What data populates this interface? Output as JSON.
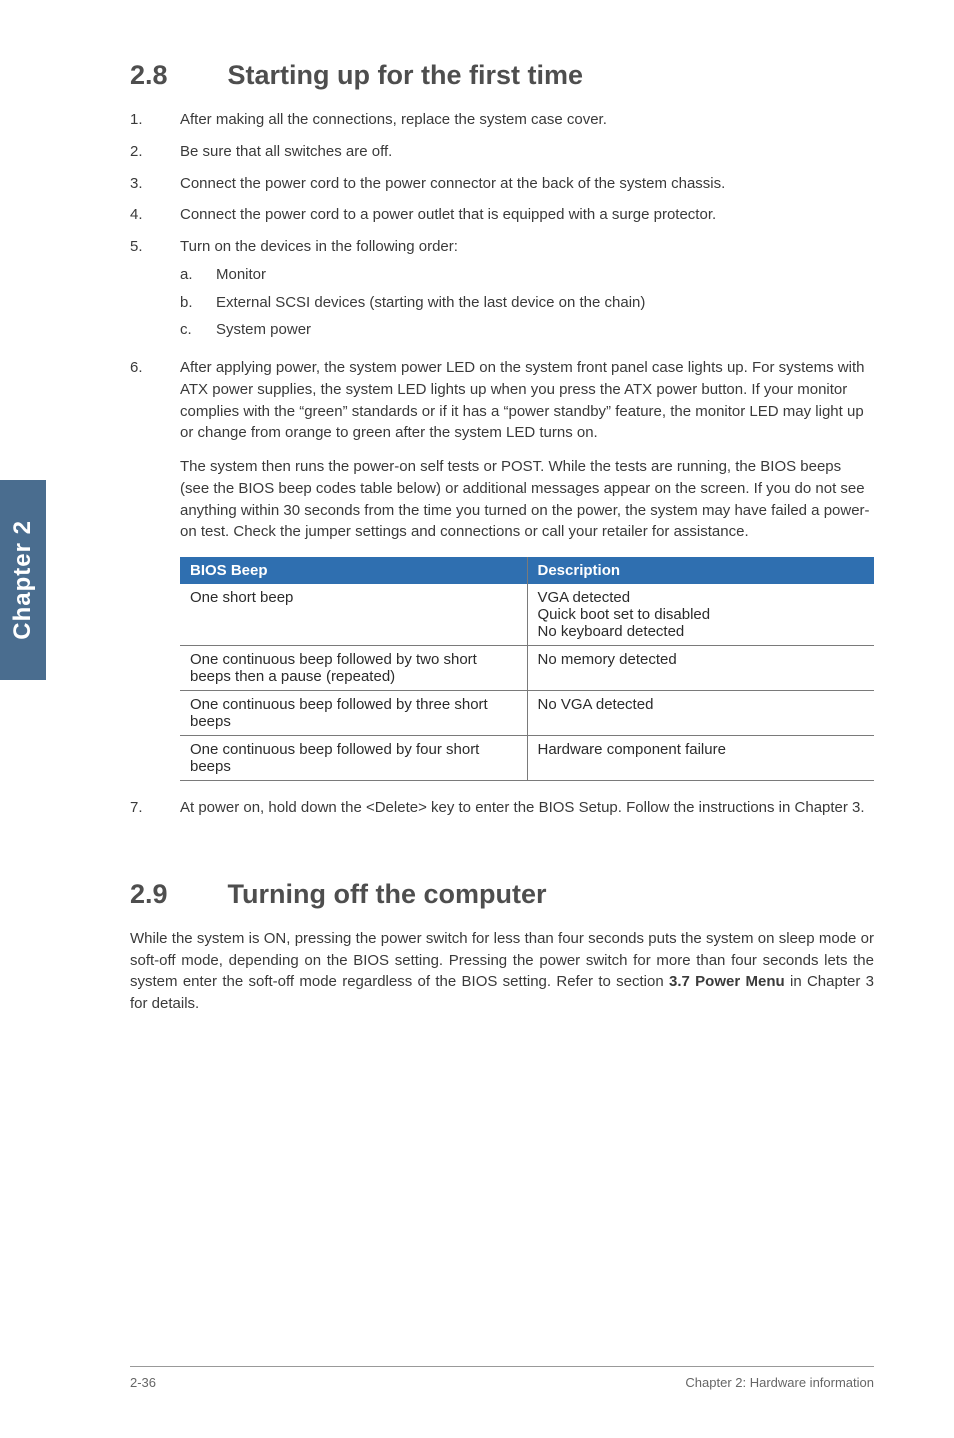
{
  "side_tab": "Chapter 2",
  "section28": {
    "num": "2.8",
    "title": "Starting up for the first time",
    "items": [
      {
        "n": "1.",
        "text": "After making all the connections, replace the system case cover."
      },
      {
        "n": "2.",
        "text": "Be sure that all switches are off."
      },
      {
        "n": "3.",
        "text": "Connect the power cord to the power connector at the back of the system chassis."
      },
      {
        "n": "4.",
        "text": "Connect the power cord to a power outlet that is equipped with a surge protector."
      },
      {
        "n": "5.",
        "text": "Turn on the devices in the following order:",
        "sub": [
          {
            "n": "a.",
            "text": "Monitor"
          },
          {
            "n": "b.",
            "text": "External SCSI devices (starting with the last device on the chain)"
          },
          {
            "n": "c.",
            "text": "System power"
          }
        ]
      },
      {
        "n": "6.",
        "text": "After applying power, the system power LED on the system front panel case lights up. For systems with ATX power supplies, the system LED lights up when you press the ATX power button. If your monitor complies with the “green” standards or if it has a “power standby” feature, the monitor LED may light up or change from orange to green after the system LED turns on."
      }
    ],
    "para6b": "The system then runs the power-on self tests or POST. While the tests are running, the BIOS beeps (see the BIOS beep codes table below) or additional messages appear on the screen. If you do not see anything within 30 seconds from the time you turned on the power, the system may have failed a power-on test. Check the jumper settings and connections or call your retailer for assistance.",
    "table": {
      "h1": "BIOS Beep",
      "h2": "Description",
      "rows": [
        {
          "c1": "One short beep",
          "c2": "VGA detected\nQuick boot set to disabled\nNo keyboard detected"
        },
        {
          "c1": "One continuous beep followed by two short beeps then a pause (repeated)",
          "c2": "No memory detected"
        },
        {
          "c1": "One continuous beep followed by three short beeps",
          "c2": "No VGA detected"
        },
        {
          "c1": "One continuous beep followed by four short beeps",
          "c2": "Hardware component failure"
        }
      ]
    },
    "item7": {
      "n": "7.",
      "text": "At power on, hold down the <Delete> key to enter the BIOS Setup. Follow the instructions in Chapter 3."
    }
  },
  "section29": {
    "num": "2.9",
    "title": "Turning off the computer",
    "body": "While the system is ON, pressing the power switch for less than four seconds puts the system on sleep mode or soft-off mode, depending on the BIOS setting. Pressing the power switch for more than four seconds lets the system enter the soft-off mode regardless of the BIOS setting. Refer to section 3.7 Power Menu in Chapter 3 for details."
  },
  "footer": {
    "left": "2-36",
    "right": "Chapter 2: Hardware information"
  }
}
